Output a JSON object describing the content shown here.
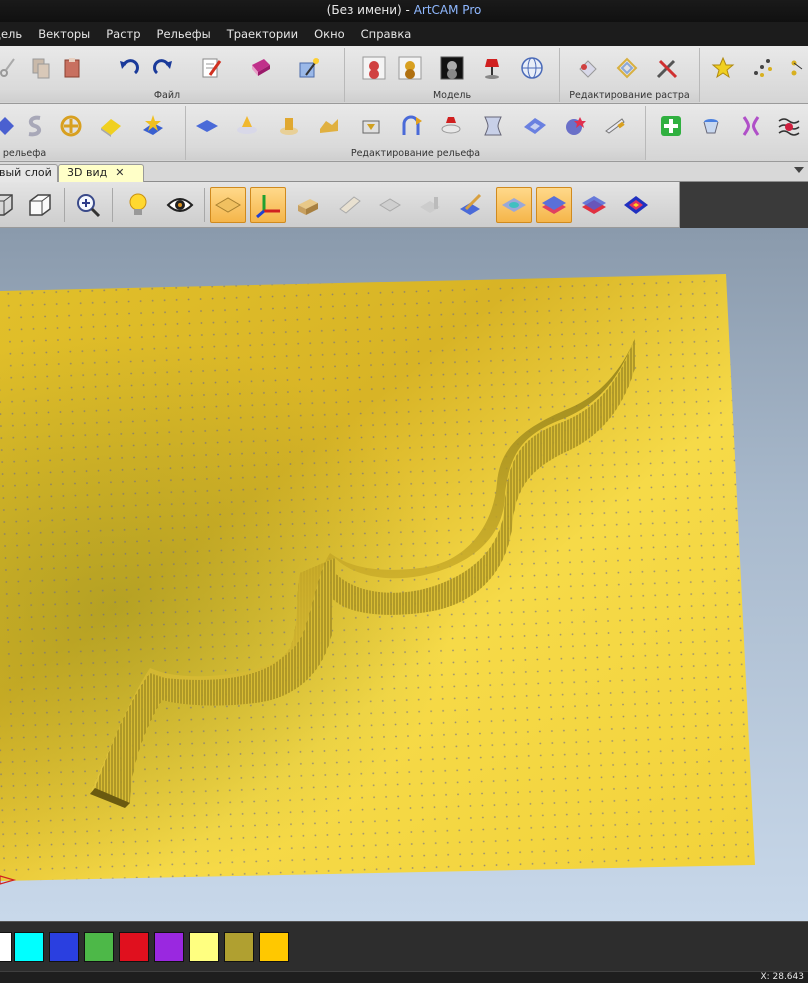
{
  "window": {
    "doc_name": "(Без имени)",
    "separator": " - ",
    "app_name": "ArtCAM Pro"
  },
  "menu": [
    "одель",
    "Векторы",
    "Растр",
    "Рельефы",
    "Траектории",
    "Окно",
    "Справка"
  ],
  "ribbon": {
    "group_file": "Файл",
    "group_model": "Модель",
    "group_raster_edit": "Редактирование растра",
    "group_relief_partial": "е рельефа",
    "group_relief_edit": "Редактирование рельефа"
  },
  "tabs": {
    "layer_tab": "вый слой",
    "view3d_tab": "3D вид",
    "close_glyph": "✕"
  },
  "palette": {
    "colors": [
      "#ffffff",
      "#00ffff",
      "#2a3fe0",
      "#4db848",
      "#e0101e",
      "#9a28e0",
      "#ffff80",
      "#b0a030",
      "#ffc800"
    ]
  },
  "status": {
    "coord_text": "X: 28.643"
  },
  "colors": {
    "relief": "#f2d33c",
    "relief_shadow": "#b89a1a",
    "active_tab": "#ffffc8"
  }
}
